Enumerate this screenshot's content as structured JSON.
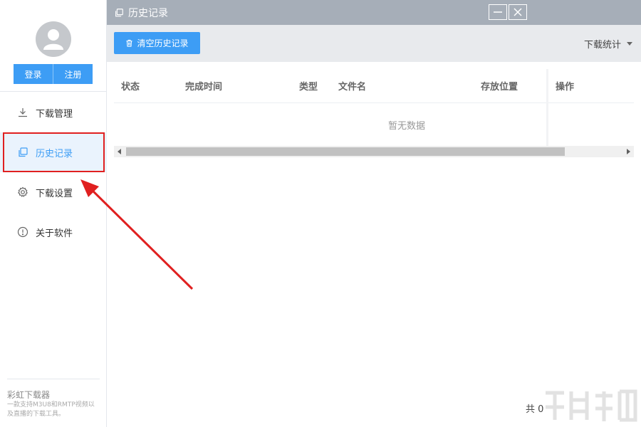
{
  "sidebar": {
    "login_label": "登录",
    "register_label": "注册",
    "items": [
      {
        "label": "下载管理",
        "icon": "download-icon"
      },
      {
        "label": "历史记录",
        "icon": "history-icon"
      },
      {
        "label": "下载设置",
        "icon": "gear-icon"
      },
      {
        "label": "关于软件",
        "icon": "info-icon"
      }
    ],
    "active_index": 1,
    "brand_title": "彩虹下载器",
    "brand_desc": "一款支持M3U8和RMTP视频以及直播的下载工具。"
  },
  "window": {
    "title": "历史记录",
    "title_icon": "history-icon"
  },
  "toolbar": {
    "clear_label": "清空历史记录",
    "stats_label": "下载统计"
  },
  "table": {
    "columns": [
      "状态",
      "完成时间",
      "类型",
      "文件名",
      "存放位置",
      "操作"
    ],
    "empty_text": "暂无数据"
  },
  "footer": {
    "total_label": "共 0"
  },
  "colors": {
    "accent": "#3d9df5",
    "titlebar": "#a6aeb8",
    "annotation": "#e02020"
  }
}
